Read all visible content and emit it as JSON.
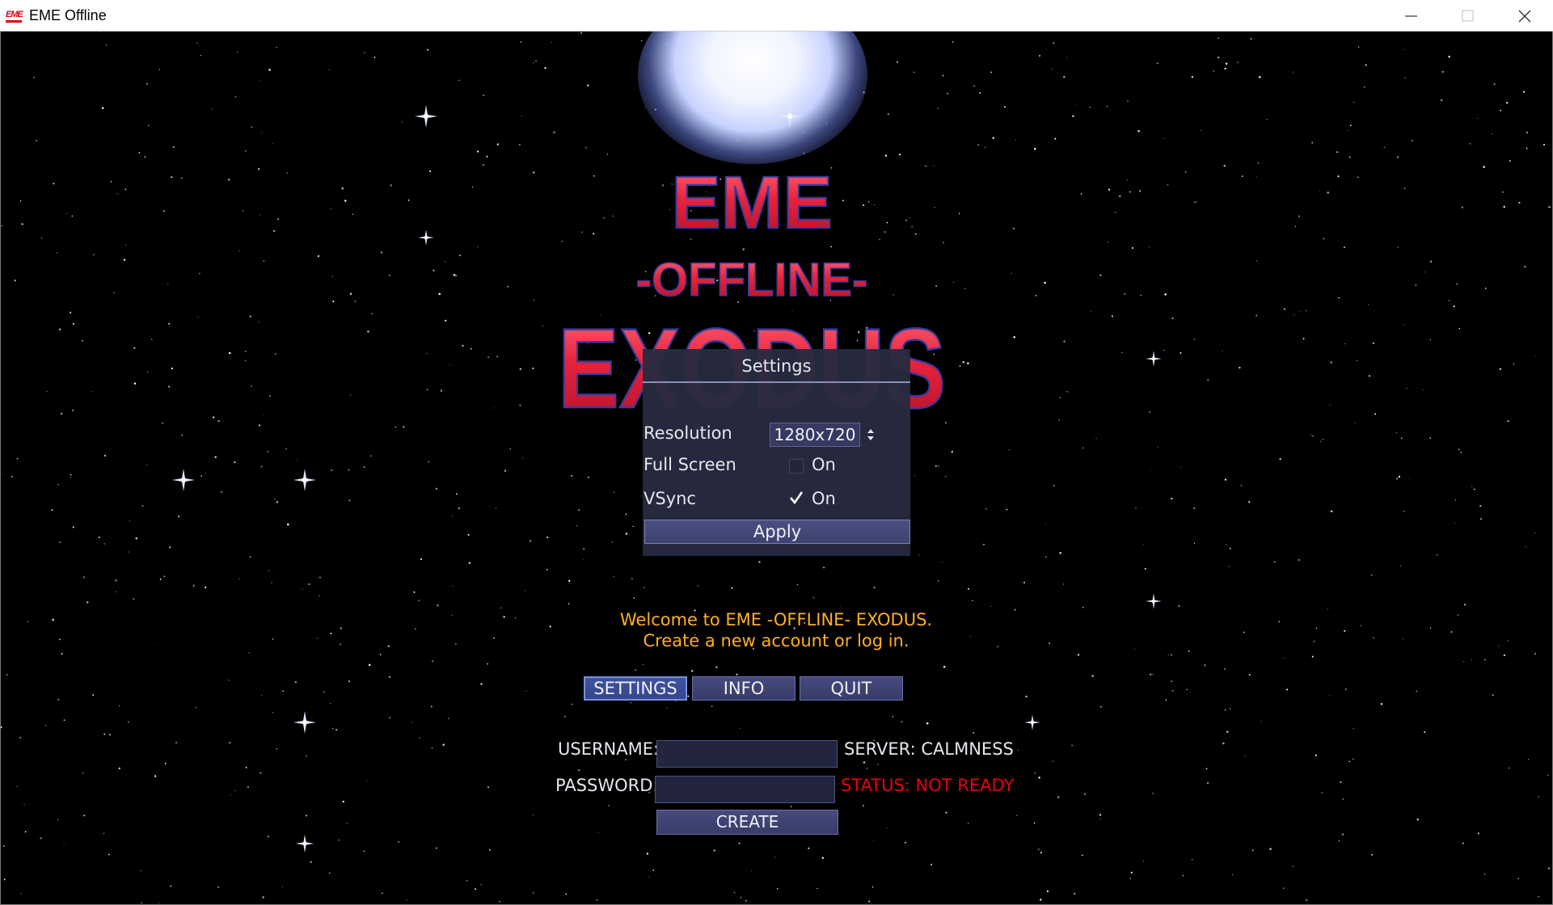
{
  "window": {
    "title": "EME Offline",
    "icon_text": "EME",
    "icon": "app-logo-icon",
    "controls": [
      "minimize-icon",
      "maximize-icon",
      "close-icon"
    ]
  },
  "logo": {
    "line1": "EME",
    "line2": "-OFFLINE-",
    "line3": "EXODUS",
    "color": "#e8233c"
  },
  "settings": {
    "title": "Settings",
    "resolution_label": "Resolution",
    "resolution_value": "1280x720",
    "fullscreen_label": "Full Screen",
    "fullscreen_option": "On",
    "fullscreen_checked": false,
    "vsync_label": "VSync",
    "vsync_option": "On",
    "vsync_checked": true,
    "apply_label": "Apply"
  },
  "welcome": {
    "line1": "Welcome to EME -OFFLINE- EXODUS.",
    "line2": "Create a new account or log in.",
    "color": "#ffb020"
  },
  "menu": {
    "settings_label": "SETTINGS",
    "info_label": "INFO",
    "quit_label": "QUIT"
  },
  "login": {
    "username_label": "USERNAME:",
    "username_value": "",
    "password_label": "PASSWORD:",
    "password_value": "",
    "server_text": "SERVER: CALMNESS",
    "status_text": "STATUS: NOT READY",
    "status_color": "#e80010",
    "create_label": "CREATE"
  }
}
